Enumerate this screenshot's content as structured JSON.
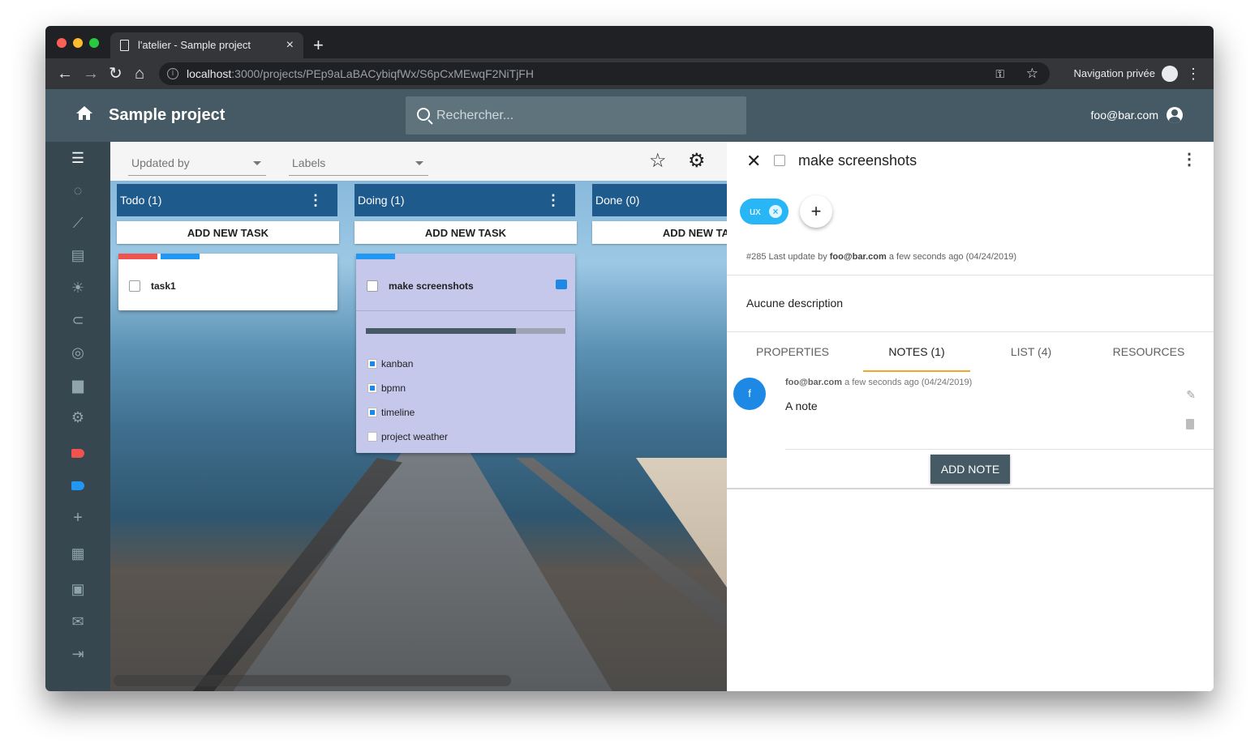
{
  "browser": {
    "tab_title": "l'atelier - Sample project",
    "url_host": "localhost",
    "url_path": ":3000/projects/PEp9aLaBACybiqfWx/S6pCxMEwqF2NiTjFH",
    "private_label": "Navigation privée"
  },
  "header": {
    "title": "Sample project",
    "search_placeholder": "Rechercher...",
    "user_email": "foo@bar.com"
  },
  "sidebar": {
    "icons": [
      "list-icon",
      "circle-icon",
      "trending-icon",
      "calendar-icon",
      "brightness-icon",
      "attachment-icon",
      "target-icon",
      "trash-icon",
      "settings-icon",
      "label-red-icon",
      "label-blue-icon",
      "add-icon",
      "dashboard-icon",
      "images-icon",
      "mail-icon",
      "exit-icon"
    ],
    "label_colors": [
      "#ef5350",
      "#2196f3"
    ]
  },
  "filters": {
    "updated_by": "Updated by",
    "labels": "Labels"
  },
  "columns": [
    {
      "title": "Todo (1)",
      "add_label": "ADD NEW TASK"
    },
    {
      "title": "Doing (1)",
      "add_label": "ADD NEW TASK"
    },
    {
      "title": "Done (0)",
      "add_label": "ADD NEW TASK"
    }
  ],
  "cards": {
    "task1": {
      "title": "task1",
      "labels": [
        "#ef5350",
        "#2196f3"
      ]
    },
    "make_screenshots": {
      "title": "make screenshots",
      "labels": [
        "#2196f3"
      ],
      "progress": 0.75,
      "checklist": [
        {
          "label": "kanban",
          "checked": true
        },
        {
          "label": "bpmn",
          "checked": true
        },
        {
          "label": "timeline",
          "checked": true
        },
        {
          "label": "project weather",
          "checked": false
        }
      ]
    }
  },
  "detail": {
    "title": "make screenshots",
    "chip": "ux",
    "meta_prefix": "#285 Last update by",
    "meta_user": "foo@bar.com",
    "meta_suffix": "a few seconds ago (04/24/2019)",
    "description": "Aucune description",
    "tabs": [
      "PROPERTIES",
      "NOTES (1)",
      "LIST (4)",
      "RESOURCES"
    ],
    "active_tab": "NOTES (1)",
    "note": {
      "avatar": "f",
      "author": "foo@bar.com",
      "time": "a few seconds ago (04/24/2019)",
      "text": "A note"
    },
    "add_note": "ADD NOTE"
  },
  "colors": {
    "appbar": "#455a64",
    "column_header": "#1f5a8c",
    "chip": "#29b6f6",
    "active_tab_indicator": "#f5a623",
    "doing_card_bg": "#c5c8ea"
  }
}
